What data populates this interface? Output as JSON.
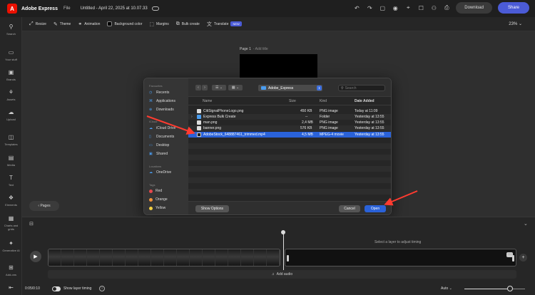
{
  "topbar": {
    "logo_letter": "A",
    "app_name": "Adobe Express",
    "file_label": "File",
    "doc_title": "Untitled - April 22, 2025 at 10.07.33",
    "download_label": "Download",
    "share_label": "Share"
  },
  "sidebar": {
    "items": [
      {
        "label": "Search",
        "icon": "search-icon"
      },
      {
        "label": "Your stuff",
        "icon": "folder-icon"
      },
      {
        "label": "Brands",
        "icon": "brand-icon"
      },
      {
        "label": "Assets",
        "icon": "assets-icon"
      },
      {
        "label": "Upload",
        "icon": "upload-icon"
      },
      {
        "label": "Templates",
        "icon": "templates-icon"
      },
      {
        "label": "Media",
        "icon": "media-icon"
      },
      {
        "label": "Text",
        "icon": "text-icon"
      },
      {
        "label": "Elements",
        "icon": "elements-icon"
      },
      {
        "label": "Charts and grids",
        "icon": "charts-icon"
      },
      {
        "label": "Generative AI",
        "icon": "generative-ai-icon"
      },
      {
        "label": "Add-ons",
        "icon": "addons-icon"
      }
    ]
  },
  "toolbar": {
    "resize": "Resize",
    "theme": "Theme",
    "animation": "Animation",
    "background_color": "Background color",
    "margins": "Margins",
    "bulk_create": "Bulk create",
    "translate": "Translate",
    "new_badge": "NEW",
    "zoom": "23%"
  },
  "canvas": {
    "page_label": "Page 1",
    "page_sub": "- Add title",
    "pages_button": "Pages"
  },
  "dialog": {
    "sidebar": {
      "favourites_label": "Favourites",
      "favourites": [
        "Recents",
        "Applications",
        "Downloads"
      ],
      "icloud_label": "iCloud",
      "icloud": [
        "iCloud Drive",
        "Documents",
        "Desktop",
        "Shared"
      ],
      "locations_label": "Locations",
      "locations": [
        "OneDrive"
      ],
      "tags_label": "Tags",
      "tags": [
        {
          "name": "Red",
          "color": "#e5484d"
        },
        {
          "name": "Orange",
          "color": "#f2923c"
        },
        {
          "name": "Yellow",
          "color": "#f5d142"
        }
      ]
    },
    "location": "Adobe_Express",
    "search_placeholder": "Search",
    "columns": {
      "name": "Name",
      "size": "Size",
      "kind": "Kind",
      "date": "Date Added"
    },
    "files": [
      {
        "name": "CitiSignalPhoneLogo.png",
        "size": "450 KB",
        "kind": "PNG image",
        "date": "Today at 11:09",
        "type": "file"
      },
      {
        "name": "Express Bulk Create",
        "size": "--",
        "kind": "Folder",
        "date": "Yesterday at 13:55",
        "type": "folder"
      },
      {
        "name": "man.png",
        "size": "2,4 MB",
        "kind": "PNG image",
        "date": "Yesterday at 13:55",
        "type": "file"
      },
      {
        "name": "banner.png",
        "size": "576 KB",
        "kind": "PNG image",
        "date": "Yesterday at 13:55",
        "type": "file"
      },
      {
        "name": "AdobeStock_648887461_trimmed.mp4",
        "size": "4,5 MB",
        "kind": "MPEG-4 movie",
        "date": "Yesterday at 13:55",
        "type": "movie",
        "selected": true
      }
    ],
    "show_options": "Show Options",
    "cancel": "Cancel",
    "open": "Open"
  },
  "timeline": {
    "hint": "Select a layer to adjust timing",
    "add_audio": "Add audio",
    "time": "0:05/0:10",
    "show_layer_timing": "Show layer timing",
    "info": "i",
    "zoom_mode": "Auto",
    "zoom_level": 0.75
  }
}
